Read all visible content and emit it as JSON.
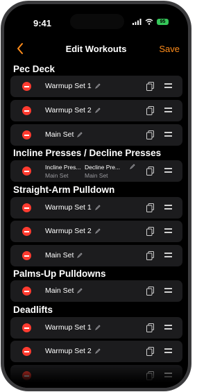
{
  "status": {
    "time": "9:41",
    "battery": "95"
  },
  "nav": {
    "back": "back",
    "title": "Edit Workouts",
    "save": "Save"
  },
  "sections": [
    {
      "title": "Pec Deck",
      "sets": [
        "Warmup Set 1",
        "Warmup Set 2",
        "Main Set"
      ]
    },
    {
      "title": "Incline Presses / Decline Presses",
      "superset": {
        "names": [
          "Incline Pres...",
          "Decline Pre..."
        ],
        "sets": [
          "Main Set",
          "Main Set"
        ]
      }
    },
    {
      "title": "Straight-Arm Pulldown",
      "sets": [
        "Warmup Set 1",
        "Warmup Set 2",
        "Main Set"
      ]
    },
    {
      "title": "Palms-Up Pulldowns",
      "sets": [
        "Main Set"
      ]
    },
    {
      "title": "Deadlifts",
      "sets": [
        "Warmup Set 1",
        "Warmup Set 2"
      ]
    }
  ],
  "colors": {
    "accent": "#ff8c1a",
    "delete": "#ff3b30",
    "row": "#1c1c1e"
  }
}
